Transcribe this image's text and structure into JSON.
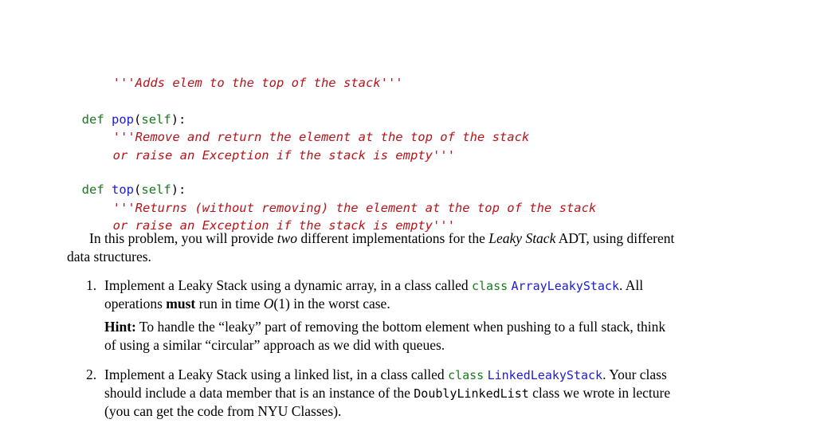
{
  "code": {
    "push_doc": "'''Adds elem to the top of the stack'''",
    "pop": {
      "def_kw": "def",
      "name": "pop",
      "open": "(",
      "self": "self",
      "close": "):",
      "doc_line1": "'''Remove and return the element at the top of the stack",
      "doc_line2": "or raise an Exception if the stack is empty'''"
    },
    "top": {
      "def_kw": "def",
      "name": "top",
      "open": "(",
      "self": "self",
      "close": "):",
      "doc_line1": "'''Returns (without removing) the element at the top of the stack",
      "doc_line2": "or raise an Exception if the stack is empty'''"
    }
  },
  "intro": {
    "part1": "In this problem, you will provide ",
    "em1": "two",
    "part2": " different implementations for the ",
    "em2": "Leaky Stack",
    "part3": " ADT, using different",
    "line2": "data structures."
  },
  "items": [
    {
      "number": "1.",
      "p1": "Implement a Leaky Stack using a dynamic array, in a class called ",
      "class_kw": "class",
      "class_name": "ArrayLeakyStack",
      "p2": ".  All",
      "l2a": "operations ",
      "l2b": "must",
      "l2c": " run in time ",
      "l2d": "O",
      "l2e": "(1) in the worst case.",
      "hint_label": "Hint:",
      "hint1": " To handle the “leaky” part of removing the bottom element when pushing to a full stack, think",
      "hint2": "of using a similar “circular” approach as we did with queues."
    },
    {
      "number": "2.",
      "p1": "Implement a Leaky Stack using a linked list, in a class called ",
      "class_kw": "class",
      "class_name": "LinkedLeakyStack",
      "p2": ". Your class",
      "l2a": "should include a data member that is an instance of the ",
      "l2tt": "DoublyLinkedList",
      "l2b": " class we wrote in lecture",
      "l3": "(you can get the code from NYU Classes)."
    }
  ]
}
